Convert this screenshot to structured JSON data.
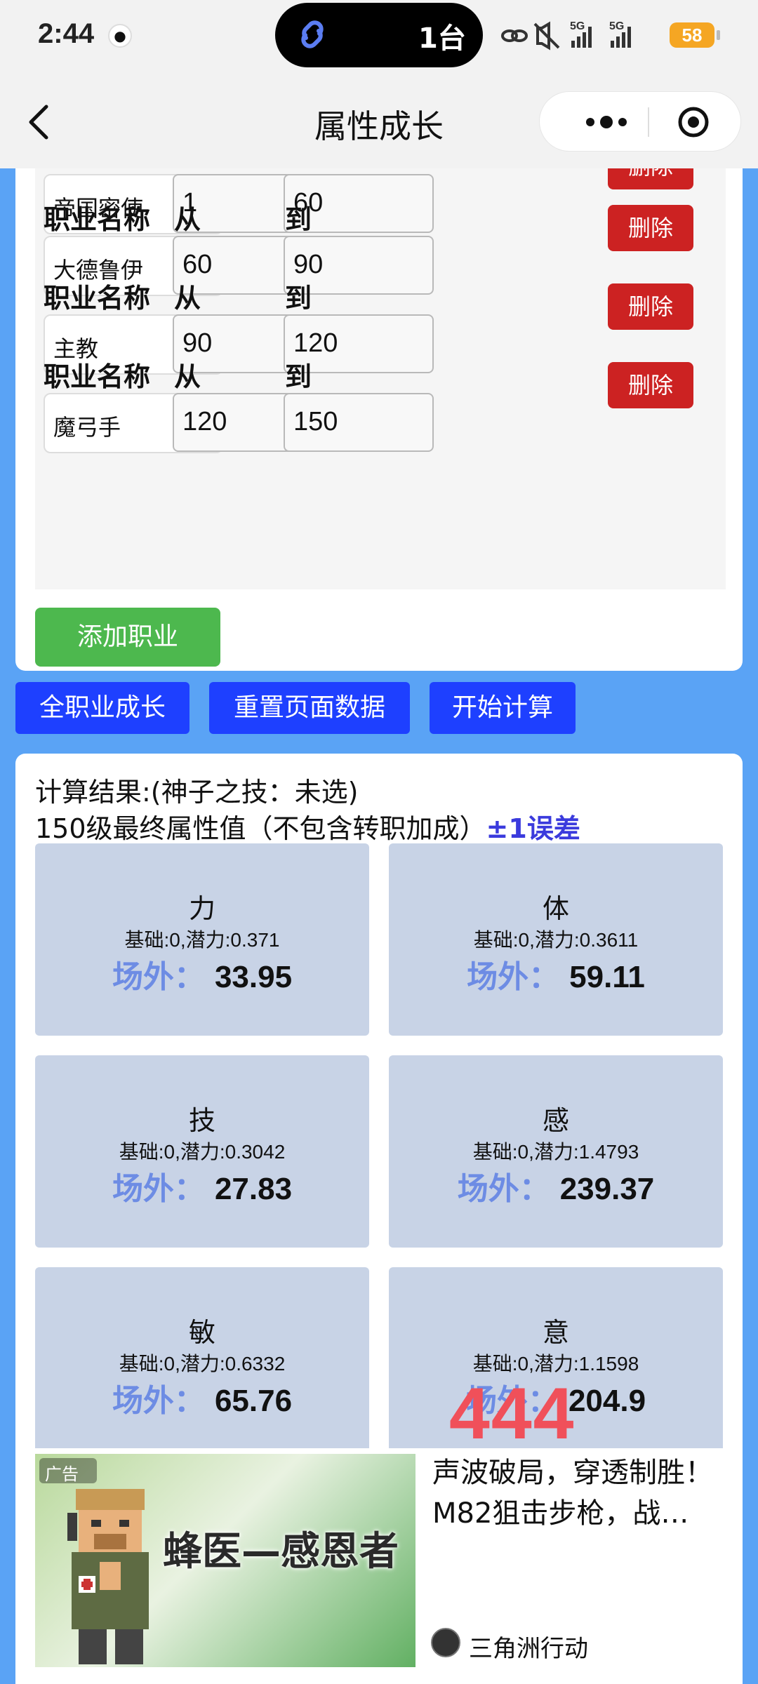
{
  "status_bar": {
    "time": "2:44",
    "pill_text": "1台",
    "battery": "58"
  },
  "nav": {
    "title": "属性成长"
  },
  "job_form": {
    "label_job": "职业名称",
    "label_from": "从",
    "label_to": "到",
    "delete_label": "删除",
    "rows": [
      {
        "job": "帝国密使",
        "from": "1",
        "to": "60"
      },
      {
        "job": "大德鲁伊",
        "from": "60",
        "to": "90"
      },
      {
        "job": "主教",
        "from": "90",
        "to": "120"
      },
      {
        "job": "魔弓手",
        "from": "120",
        "to": "150"
      }
    ],
    "add_label": "添加职业"
  },
  "actions": {
    "growth": "全职业成长",
    "reset": "重置页面数据",
    "calc": "开始计算"
  },
  "results": {
    "title": "计算结果:(神子之技：未选)",
    "subtitle": "150级最终属性值（不包含转职加成）",
    "error_note": "±1误差",
    "outside_label": "场外：",
    "stats": [
      {
        "name": "力",
        "base": "基础:0,潜力:0.371",
        "value": "33.95"
      },
      {
        "name": "体",
        "base": "基础:0,潜力:0.3611",
        "value": "59.11"
      },
      {
        "name": "技",
        "base": "基础:0,潜力:0.3042",
        "value": "27.83"
      },
      {
        "name": "感",
        "base": "基础:0,潜力:1.4793",
        "value": "239.37"
      },
      {
        "name": "敏",
        "base": "基础:0,潜力:0.6332",
        "value": "65.76"
      },
      {
        "name": "意",
        "base": "基础:0,潜力:1.1598",
        "value": "204.9"
      }
    ],
    "overlay_number": "444"
  },
  "ad": {
    "tag": "广告",
    "image_text": "蜂医—感恩者",
    "headline": "声波破局，穿透制胜！M82狙击步枪，战…",
    "brand": "三角洲行动"
  },
  "colors": {
    "page_bg": "#5aa3f5",
    "action_button": "#1e40ff",
    "delete_button": "#cc2222",
    "add_button": "#4db84e",
    "stat_card": "#c8d3e6",
    "overlay_number": "#f0505a"
  }
}
